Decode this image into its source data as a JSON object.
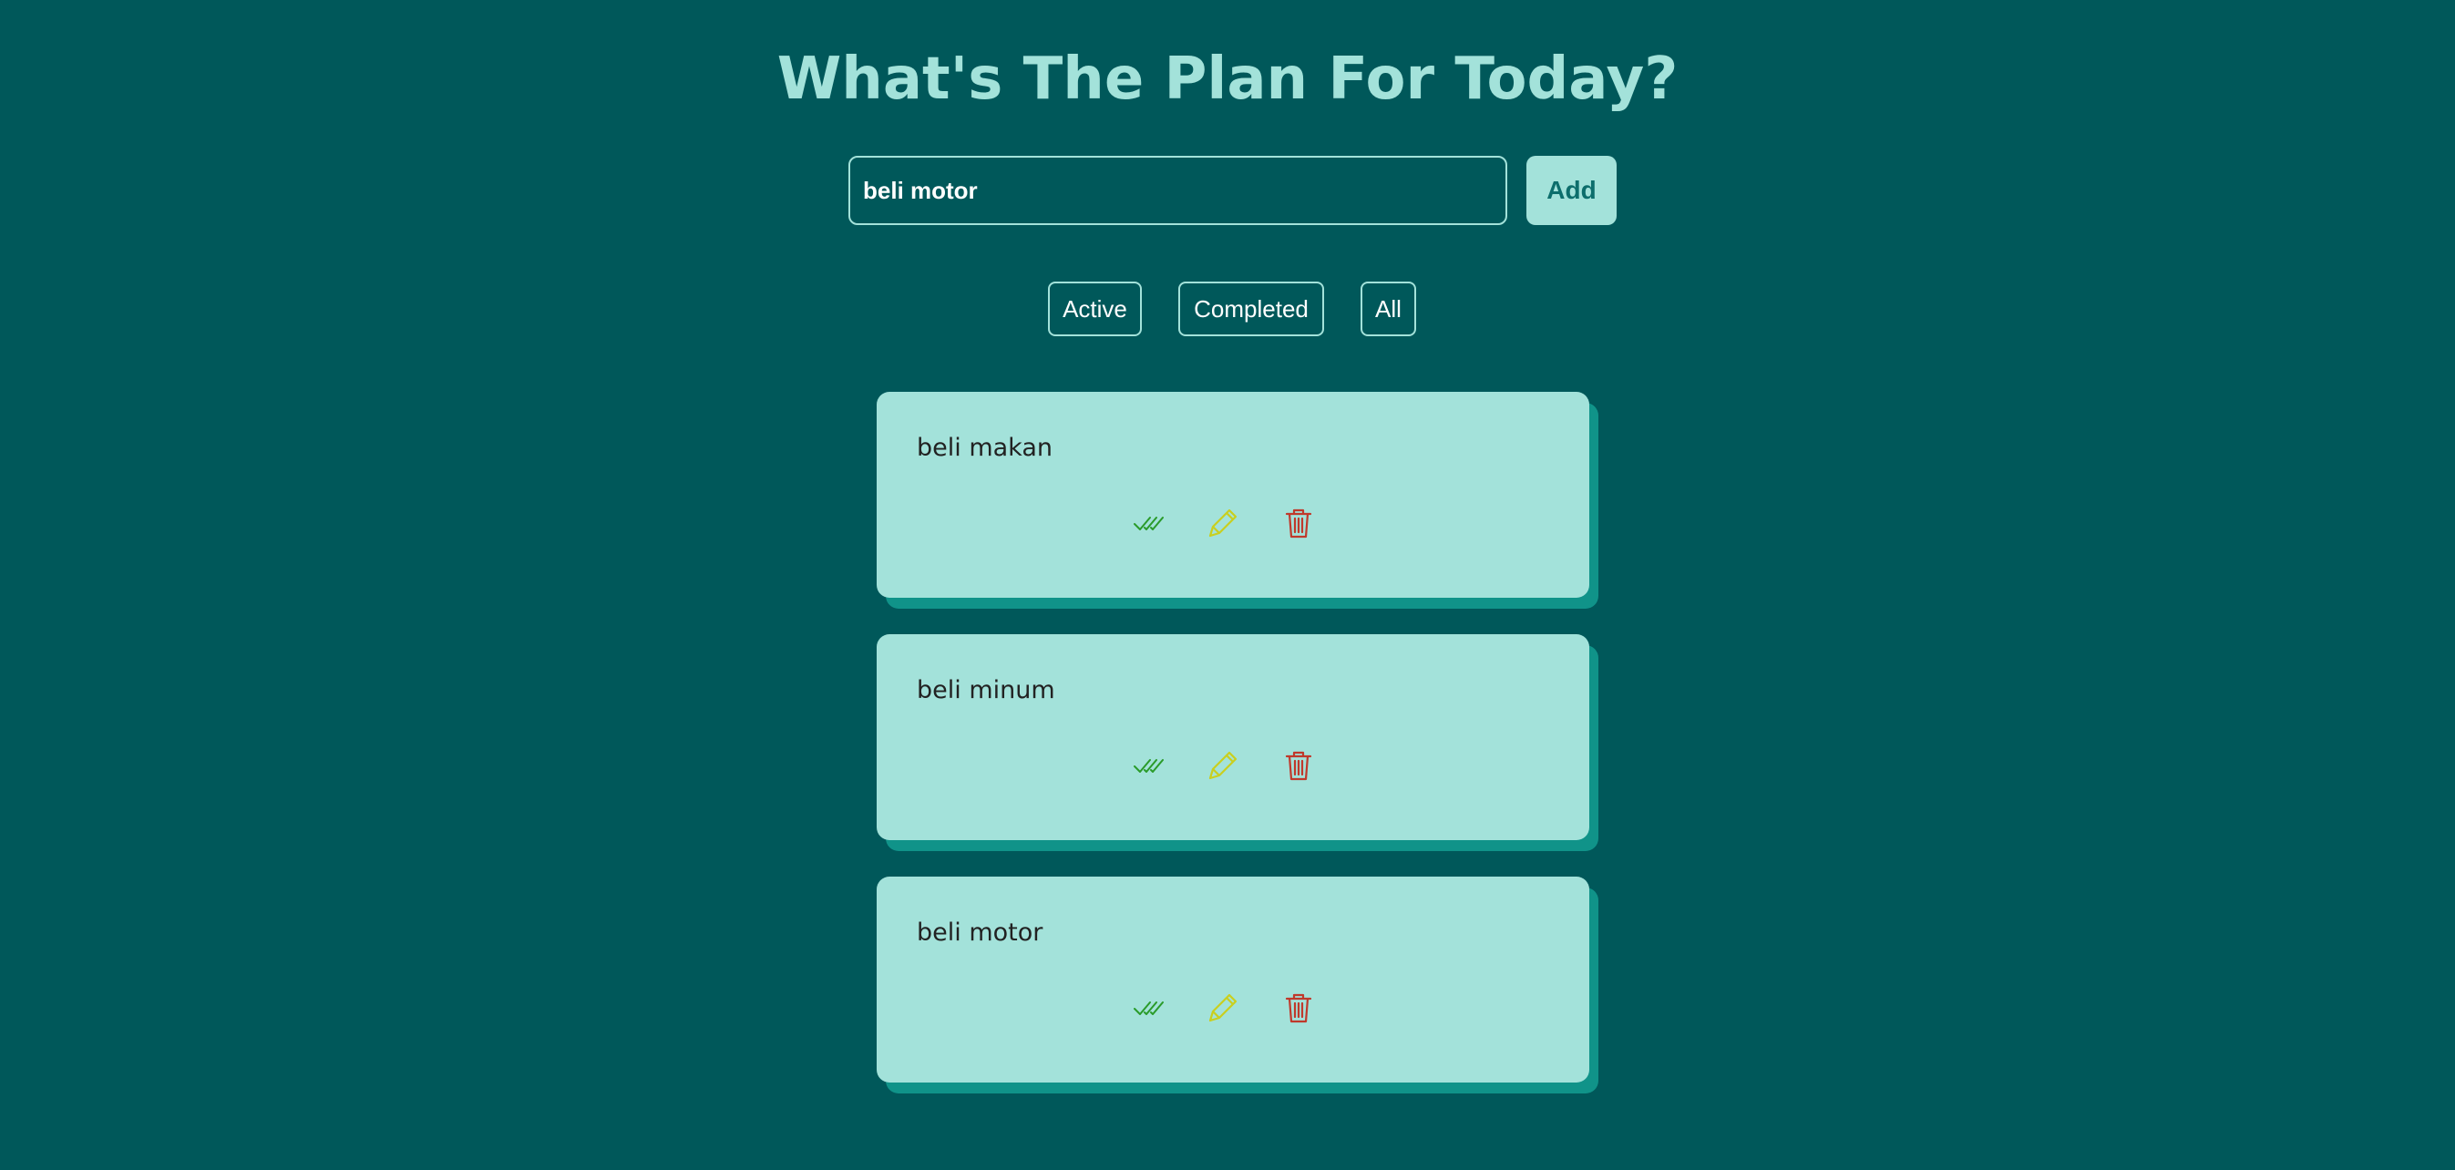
{
  "header": {
    "title": "What's The Plan For Today?"
  },
  "form": {
    "input_value": "beli motor",
    "add_label": "Add"
  },
  "filters": {
    "active": "Active",
    "completed": "Completed",
    "all": "All"
  },
  "todos": [
    {
      "text": "beli makan"
    },
    {
      "text": "beli minum"
    },
    {
      "text": "beli motor"
    }
  ],
  "icons": {
    "complete": "double-check-icon",
    "edit": "pencil-icon",
    "delete": "trash-icon"
  },
  "colors": {
    "background": "#00585a",
    "accent": "#a3e2da",
    "card_shadow": "#109389",
    "complete_icon": "#2a9b2a",
    "edit_icon": "#c9cf1f",
    "delete_icon": "#c0392b"
  }
}
